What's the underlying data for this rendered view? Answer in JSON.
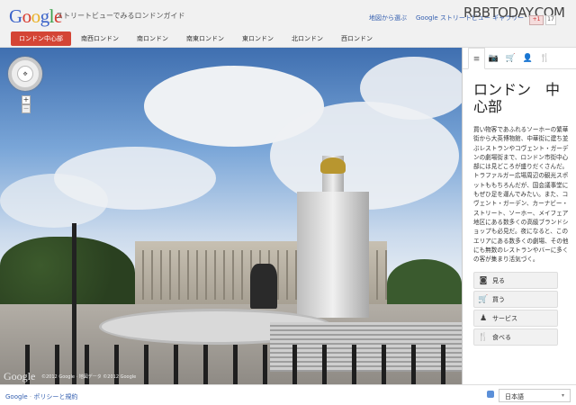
{
  "header": {
    "logo": "Google",
    "subtitle": "ストリートビューでみるロンドンガイド",
    "links": [
      "地図から選ぶ",
      "Google ストリートビュー ギャラリー"
    ],
    "watermark": "RBBTODAY.COM",
    "gplus": "+1",
    "gcount": "17"
  },
  "nav": {
    "items": [
      "ロンドン中心部",
      "南西ロンドン",
      "南ロンドン",
      "南東ロンドン",
      "東ロンドン",
      "北ロンドン",
      "西ロンドン"
    ]
  },
  "streetview": {
    "logo": "Google",
    "copyright": "©2012 Google · 地図データ ©2012 Google",
    "zoom_in": "+",
    "zoom_out": "−"
  },
  "sidebar": {
    "tabs": [
      "≡",
      "📷",
      "🛒",
      "👤",
      "🍴"
    ],
    "title": "ロンドン　中心部",
    "description": "買い物客であふれるソーホーの繁華街から大英博物館、中華街に建ち並ぶレストランやコヴェント・ガーデンの劇場街まで、ロンドン市街中心部には見どころが盛りだくさんだ。トラファルガー広場周辺の観光スポットももちろんだが、国会議事堂にもぜひ足を運んでみたい。また、コヴェント・ガーデン、カーナビー・ストリート、ソーホー、メイフェア地区にある数多くの高級ブランドショップも必見だ。夜になると、このエリアにある数多くの劇場、その他にも無数のレストランやバーに多くの客が集まり活気づく。",
    "categories": [
      {
        "icon": "◙",
        "label": "見る"
      },
      {
        "icon": "🛒",
        "label": "買う"
      },
      {
        "icon": "♟",
        "label": "サービス"
      },
      {
        "icon": "🍴",
        "label": "食べる"
      }
    ]
  },
  "footer": {
    "google": "Google",
    "separator": "·",
    "policy": "ポリシーと規約",
    "language": "日本語",
    "chevron": "▾"
  }
}
